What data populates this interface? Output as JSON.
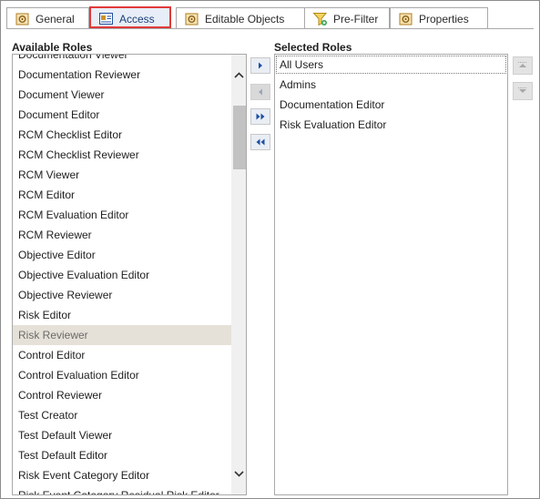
{
  "tabs": [
    {
      "label": "General",
      "icon": "gear-document-icon",
      "active": false
    },
    {
      "label": "Access",
      "icon": "access-card-icon",
      "active": true
    },
    {
      "label": "Editable Objects",
      "icon": "gear-document-icon",
      "active": false
    },
    {
      "label": "Pre-Filter",
      "icon": "filter-icon",
      "active": false
    },
    {
      "label": "Properties",
      "icon": "gear-document-icon",
      "active": false
    }
  ],
  "available": {
    "heading": "Available Roles",
    "items": [
      "Documentation Viewer",
      "Documentation Reviewer",
      "Document Viewer",
      "Document Editor",
      "RCM Checklist Editor",
      "RCM Checklist Reviewer",
      "RCM Viewer",
      "RCM Editor",
      "RCM Evaluation Editor",
      "RCM Reviewer",
      "Objective Editor",
      "Objective Evaluation Editor",
      "Objective Reviewer",
      "Risk Editor",
      "Risk Reviewer",
      "Control Editor",
      "Control Evaluation Editor",
      "Control Reviewer",
      "Test Creator",
      "Test Default Viewer",
      "Test Default Editor",
      "Risk Event Category Editor",
      "Risk Event Category Residual Risk Editor"
    ],
    "selected_item": "Risk Reviewer"
  },
  "selected": {
    "heading": "Selected Roles",
    "items": [
      "All Users",
      "Admins",
      "Documentation Editor",
      "Risk Evaluation Editor"
    ],
    "focused_item": "All Users"
  },
  "buttons": {
    "add": {
      "icon": "chevron-right-icon",
      "enabled": true
    },
    "remove": {
      "icon": "chevron-left-icon",
      "enabled": false
    },
    "add_all": {
      "icon": "double-chevron-right-icon",
      "enabled": true
    },
    "remove_all": {
      "icon": "double-chevron-left-icon",
      "enabled": true
    },
    "move_up": {
      "icon": "move-up-icon",
      "enabled": false
    },
    "move_down": {
      "icon": "move-down-icon",
      "enabled": false
    }
  },
  "colors": {
    "accent_blue": "#1f4fa0",
    "highlight_border": "#e03a3a",
    "selected_row": "#e6e1d8",
    "tab_icon_gold": "#c8912a"
  }
}
